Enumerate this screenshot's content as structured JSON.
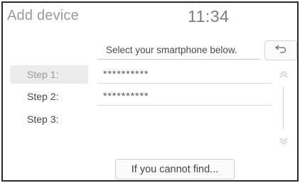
{
  "header": {
    "title": "Add device",
    "clock": "11:34"
  },
  "instruction": "Select your smartphone below.",
  "back_button": {
    "icon": "back-arrow-icon"
  },
  "steps": [
    {
      "label": "Step 1:",
      "value": "**********",
      "active": true
    },
    {
      "label": "Step 2:",
      "value": "**********",
      "active": false
    },
    {
      "label": "Step 3:",
      "value": "",
      "active": false
    }
  ],
  "scroll": {
    "up_icon": "double-chevron-up-icon",
    "down_icon": "double-chevron-down-icon"
  },
  "footer": {
    "find_button_label": "If you cannot find..."
  },
  "colors": {
    "accent_gray": "#9a9a9a",
    "border": "#2a2a2a"
  }
}
